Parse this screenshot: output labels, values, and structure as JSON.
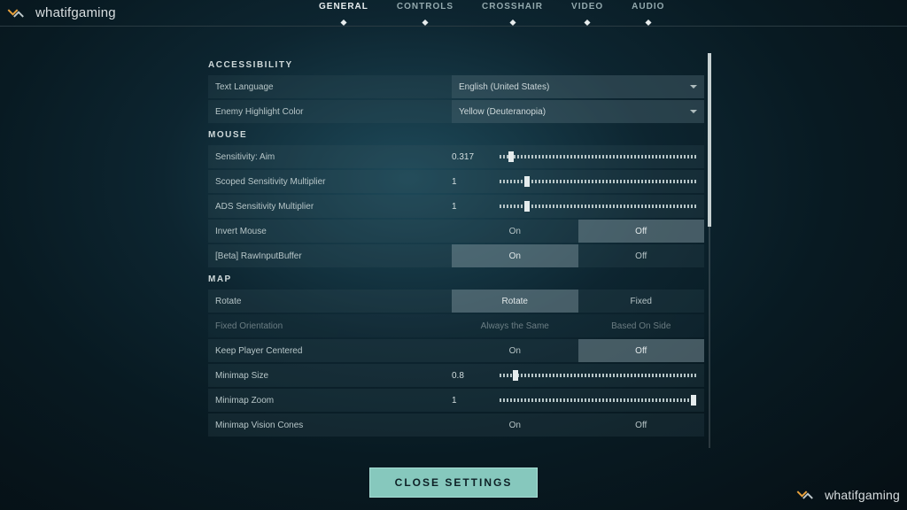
{
  "brand": "whatifgaming",
  "tabs": [
    "GENERAL",
    "CONTROLS",
    "CROSSHAIR",
    "VIDEO",
    "AUDIO"
  ],
  "active_tab": "GENERAL",
  "close_button": "CLOSE SETTINGS",
  "sections": {
    "accessibility": {
      "title": "ACCESSIBILITY",
      "text_language": {
        "label": "Text Language",
        "value": "English (United States)"
      },
      "enemy_highlight": {
        "label": "Enemy Highlight Color",
        "value": "Yellow (Deuteranopia)"
      }
    },
    "mouse": {
      "title": "MOUSE",
      "sensitivity": {
        "label": "Sensitivity: Aim",
        "value": "0.317",
        "knob_pct": 6
      },
      "scoped": {
        "label": "Scoped Sensitivity Multiplier",
        "value": "1",
        "knob_pct": 14
      },
      "ads": {
        "label": "ADS Sensitivity Multiplier",
        "value": "1",
        "knob_pct": 14
      },
      "invert": {
        "label": "Invert Mouse",
        "options": [
          "On",
          "Off"
        ],
        "selected": "Off"
      },
      "rawinput": {
        "label": "[Beta] RawInputBuffer",
        "options": [
          "On",
          "Off"
        ],
        "selected": "On"
      }
    },
    "map": {
      "title": "MAP",
      "rotate": {
        "label": "Rotate",
        "options": [
          "Rotate",
          "Fixed"
        ],
        "selected": "Rotate"
      },
      "fixed_orientation": {
        "label": "Fixed Orientation",
        "options": [
          "Always the Same",
          "Based On Side"
        ],
        "selected": ""
      },
      "keep_centered": {
        "label": "Keep Player Centered",
        "options": [
          "On",
          "Off"
        ],
        "selected": "Off"
      },
      "minimap_size": {
        "label": "Minimap Size",
        "value": "0.8",
        "knob_pct": 8
      },
      "minimap_zoom": {
        "label": "Minimap Zoom",
        "value": "1",
        "knob_pct": 98
      },
      "vision_cones": {
        "label": "Minimap Vision Cones",
        "options": [
          "On",
          "Off"
        ],
        "selected": "On"
      }
    }
  }
}
